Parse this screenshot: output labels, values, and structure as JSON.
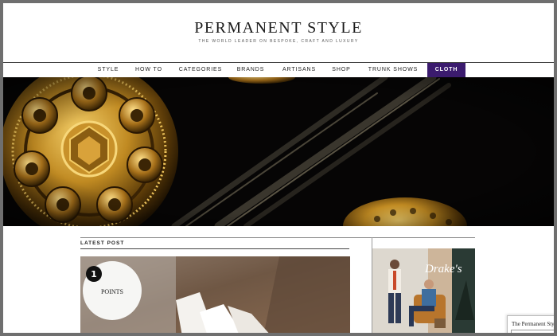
{
  "header": {
    "site_title": "PERMANENT STYLE",
    "tagline": "THE WORLD LEADER ON BESPOKE, CRAFT AND LUXURY"
  },
  "nav": {
    "items": [
      {
        "label": "STYLE"
      },
      {
        "label": "HOW TO"
      },
      {
        "label": "CATEGORIES"
      },
      {
        "label": "BRANDS"
      },
      {
        "label": "ARTISANS"
      },
      {
        "label": "SHOP"
      },
      {
        "label": "TRUNK SHOWS"
      },
      {
        "label": "CLOTH"
      }
    ],
    "active": "CLOTH",
    "active_color": "#3b1b6e"
  },
  "main": {
    "section_label": "LATEST POST",
    "post_badge_number": "1",
    "post_badge_text": "POINTS"
  },
  "sidebar_ad": {
    "brand": "Drake's"
  },
  "popup": {
    "text": "The Permanent Sty"
  }
}
